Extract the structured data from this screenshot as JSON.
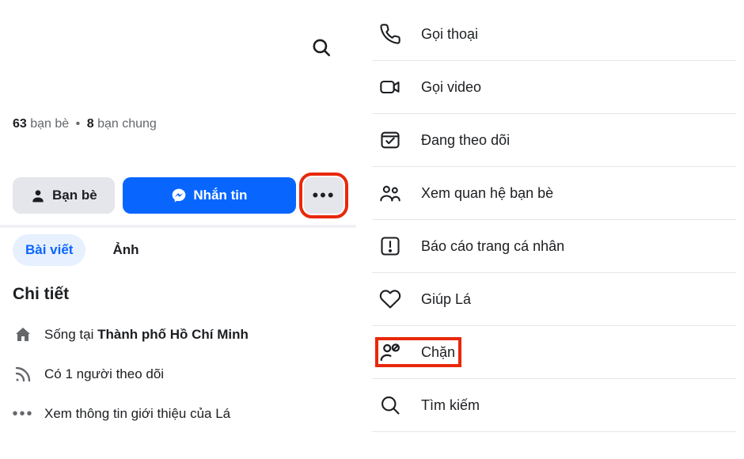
{
  "header": {
    "friend_count": "63",
    "friend_label": "bạn bè",
    "mutual_count": "8",
    "mutual_label": "bạn chung"
  },
  "actions": {
    "friends_label": "Bạn bè",
    "message_label": "Nhắn tin",
    "more_label": "•••"
  },
  "tabs": {
    "posts": "Bài viết",
    "photos": "Ảnh"
  },
  "section_title": "Chi tiết",
  "details": {
    "lives_prefix": "Sống tại ",
    "lives_place": "Thành phố Hồ Chí Minh",
    "followers": "Có 1 người theo dõi",
    "see_about": "Xem thông tin giới thiệu của Lá"
  },
  "menu": {
    "voice_call": "Gọi thoại",
    "video_call": "Gọi video",
    "following": "Đang theo dõi",
    "see_friendship": "Xem quan hệ bạn bè",
    "report_profile": "Báo cáo trang cá nhân",
    "help_name": "Giúp Lá",
    "block": "Chặn",
    "search": "Tìm kiếm"
  }
}
